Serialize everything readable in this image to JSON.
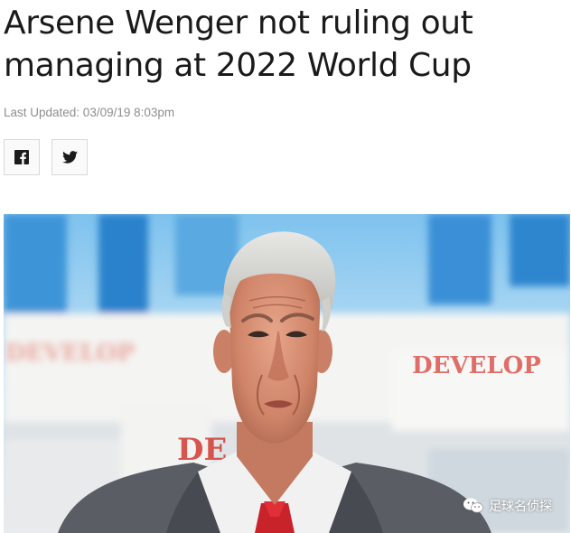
{
  "article": {
    "headline_line1": "Arsene Wenger not ruling out",
    "headline_line2": "managing at 2022 World Cup",
    "last_updated": "Last Updated: 03/09/19 8:03pm"
  },
  "share": {
    "facebook_icon": "facebook-icon",
    "twitter_icon": "twitter-icon"
  },
  "photo": {
    "stand_text_left": "DEVELOP",
    "stand_text_right": "DEVELOP",
    "seat_text": "DE",
    "watermark": "足球名侦探",
    "watermark_icon": "wechat-icon"
  },
  "colors": {
    "headline": "#1a1a1a",
    "meta": "#8e8e8e",
    "stand_red": "#d8403a",
    "stand_blue": "#3a8fd6"
  }
}
